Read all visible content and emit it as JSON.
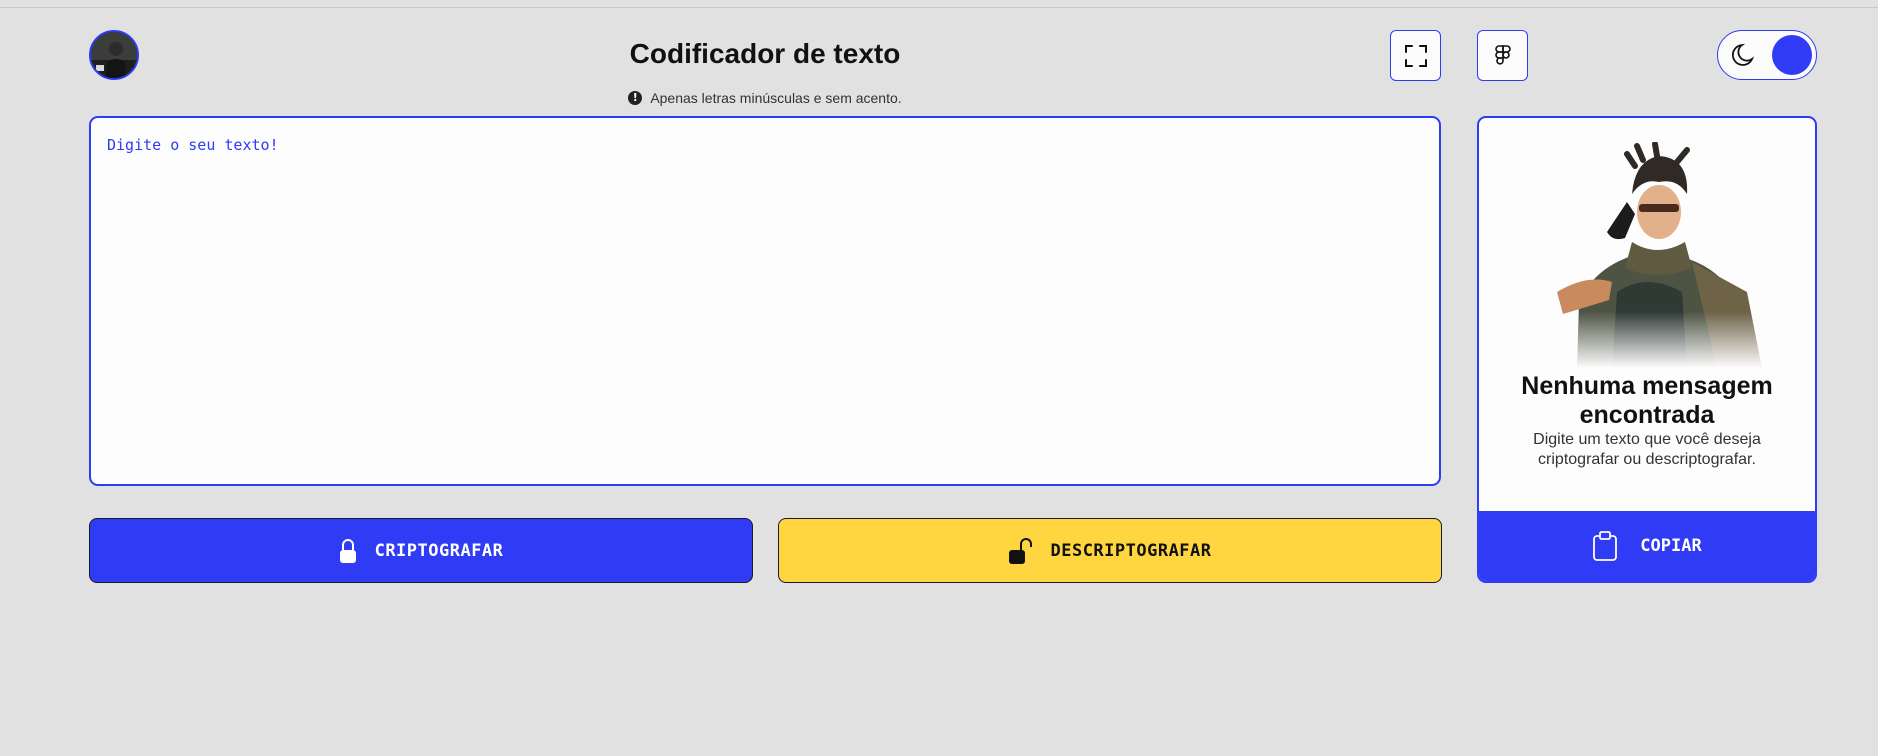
{
  "header": {
    "title": "Codificador de texto",
    "hint": "Apenas letras minúsculas e sem acento.",
    "hint_icon_glyph": "!"
  },
  "editor": {
    "placeholder": "Digite o seu texto!",
    "value": ""
  },
  "actions": {
    "encrypt_label": "CRIPTOGRAFAR",
    "decrypt_label": "DESCRIPTOGRAFAR"
  },
  "output_panel": {
    "empty_title": "Nenhuma mensagem encontrada",
    "empty_description": "Digite um texto que você deseja criptografar ou descriptografar.",
    "copy_label": "COPIAR"
  },
  "toolbar": {
    "expand_icon": "expand-icon",
    "figma_icon": "figma-icon",
    "theme_icon": "moon-icon"
  },
  "colors": {
    "accent": "#2f3bf5",
    "warning": "#ffd640",
    "background": "#e1e1e1"
  }
}
